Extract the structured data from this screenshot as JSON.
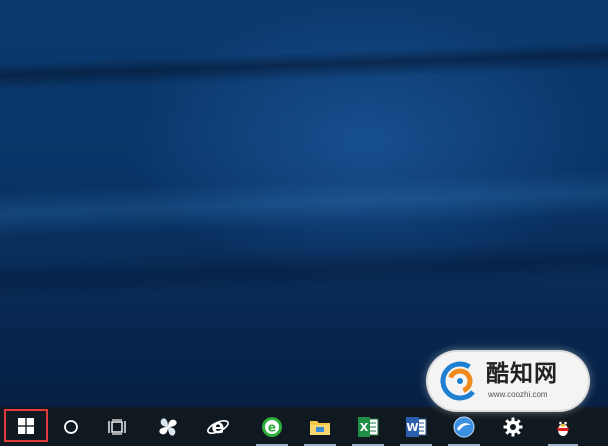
{
  "desktop": {
    "wallpaper": "windows-10-blue-light-beams",
    "colors": {
      "base": "#0a3568",
      "highlight": "#2e6eb8"
    }
  },
  "watermark": {
    "brand": "酷知网",
    "url": "www.coozhi.com",
    "logo_icon": "coozhi-logo-icon"
  },
  "taskbar": {
    "background": "#101820",
    "start_highlight_color": "#e23b3b",
    "items": [
      {
        "name": "start-button",
        "icon": "windows-logo-icon",
        "highlighted": true
      },
      {
        "name": "search-button",
        "icon": "circle-icon"
      },
      {
        "name": "task-view-button",
        "icon": "task-view-icon"
      },
      {
        "name": "pinned-app-1",
        "icon": "pinwheel-app-icon"
      },
      {
        "name": "internet-explorer-button",
        "icon": "internet-explorer-icon"
      },
      {
        "name": "green-browser-button",
        "icon": "green-e-browser-icon",
        "running": true
      },
      {
        "name": "file-explorer-button",
        "icon": "folder-icon",
        "running": true
      },
      {
        "name": "excel-button",
        "icon": "excel-icon",
        "running": true
      },
      {
        "name": "word-button",
        "icon": "word-icon",
        "running": true
      },
      {
        "name": "sogou-browser-button",
        "icon": "sogou-browser-icon",
        "running": true
      },
      {
        "name": "settings-button",
        "icon": "gear-icon"
      },
      {
        "name": "qq-button",
        "icon": "penguin-icon",
        "running": true
      }
    ]
  }
}
